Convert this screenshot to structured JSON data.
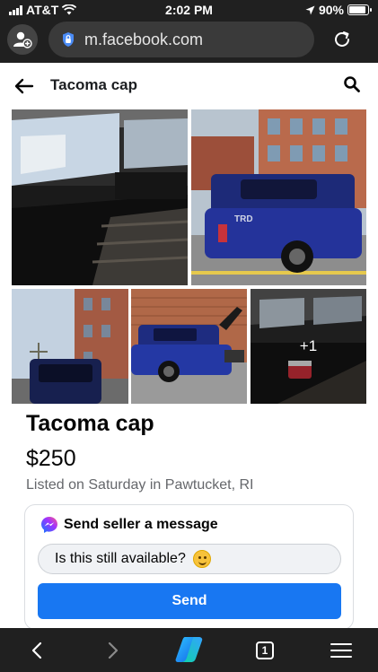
{
  "status_bar": {
    "carrier": "AT&T",
    "time": "2:02 PM",
    "battery": "90%",
    "battery_level": 0.9
  },
  "browser": {
    "url": "m.facebook.com",
    "tab_count": "1",
    "icons": {
      "profile": "add-profile-icon",
      "security": "lock-shield-icon",
      "reload": "reload-icon",
      "back": "chevron-left-icon",
      "forward": "chevron-right-icon",
      "copilot": "copilot-icon",
      "tabs": "tabs-icon",
      "menu": "hamburger-menu-icon"
    }
  },
  "header": {
    "title": "Tacoma cap",
    "back_icon": "arrow-left-icon",
    "search_icon": "search-icon"
  },
  "photos": {
    "more_count": "+1"
  },
  "listing": {
    "title": "Tacoma cap",
    "price": "$250",
    "listed": "Listed on Saturday in Pawtucket, RI"
  },
  "message": {
    "heading": "Send seller a message",
    "input_value": "Is this still available?",
    "send_label": "Send"
  },
  "colors": {
    "accent": "#1877f2",
    "chrome": "#202020",
    "truck_blue": "#1d2a78"
  }
}
